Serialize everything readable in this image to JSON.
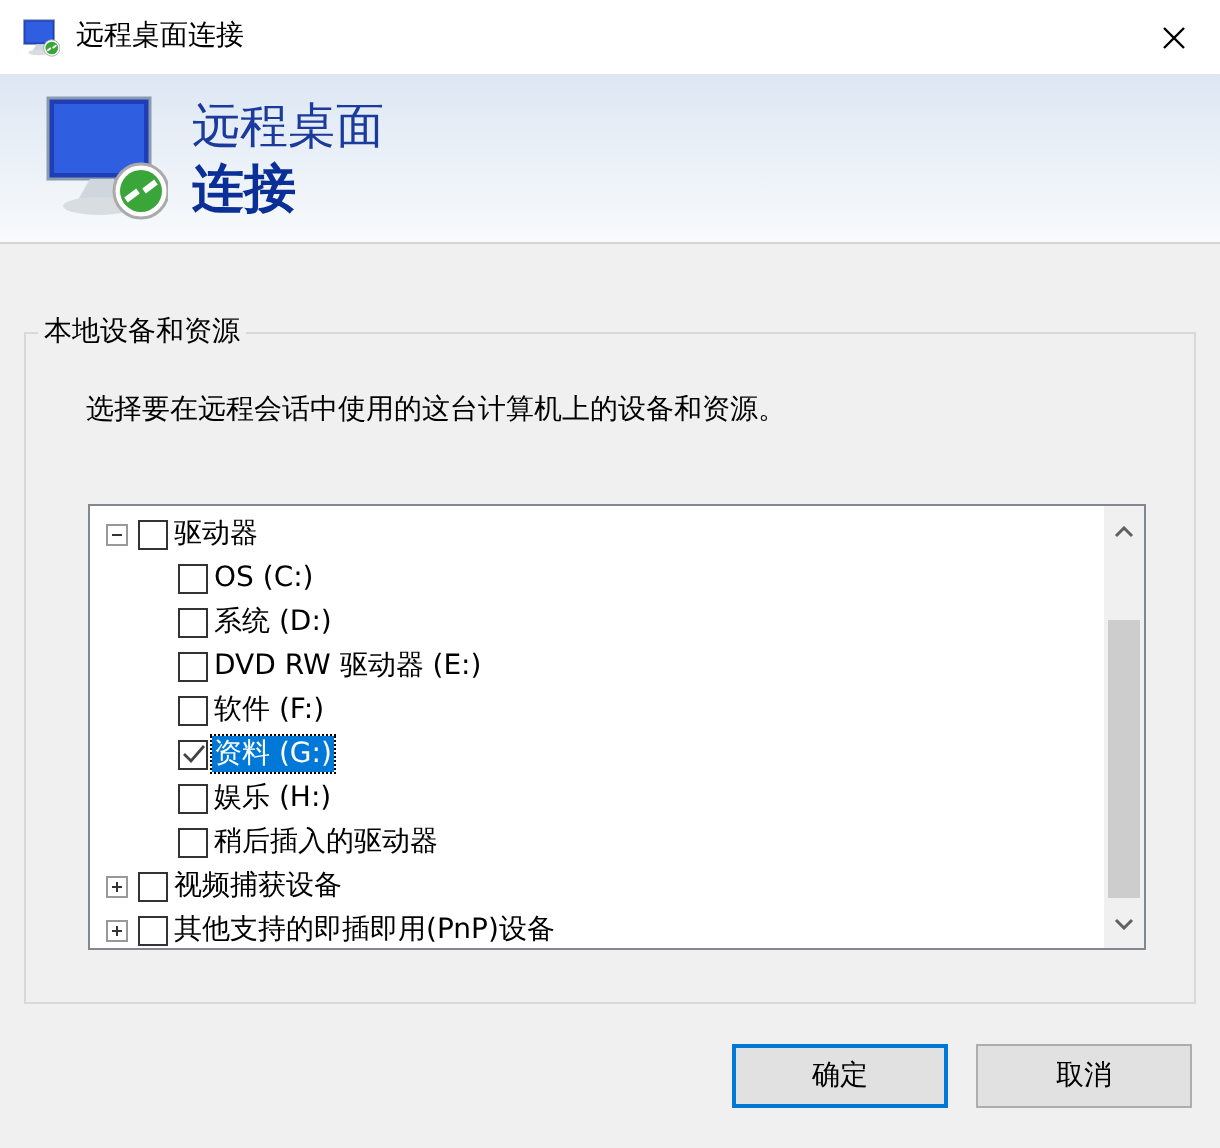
{
  "window": {
    "title": "远程桌面连接"
  },
  "banner": {
    "line_1": "远程桌面",
    "line_2": "连接"
  },
  "group": {
    "title": "本地设备和资源",
    "description": "选择要在远程会话中使用的这台计算机上的设备和资源。"
  },
  "tree": [
    {
      "label": "驱动器",
      "checked": false,
      "selected": false,
      "expanded": true,
      "children": [
        {
          "label": "OS (C:)",
          "checked": false,
          "selected": false
        },
        {
          "label": "系统 (D:)",
          "checked": false,
          "selected": false
        },
        {
          "label": "DVD RW 驱动器 (E:)",
          "checked": false,
          "selected": false
        },
        {
          "label": "软件 (F:)",
          "checked": false,
          "selected": false
        },
        {
          "label": "资料 (G:)",
          "checked": true,
          "selected": true
        },
        {
          "label": "娱乐 (H:)",
          "checked": false,
          "selected": false
        },
        {
          "label": "稍后插入的驱动器",
          "checked": false,
          "selected": false
        }
      ]
    },
    {
      "label": "视频捕获设备",
      "checked": false,
      "selected": false,
      "expanded": false
    },
    {
      "label": "其他支持的即插即用(PnP)设备",
      "checked": false,
      "selected": false,
      "expanded": false
    }
  ],
  "buttons": [
    {
      "label": "确定",
      "default": true
    },
    {
      "label": "取消",
      "default": false
    }
  ]
}
